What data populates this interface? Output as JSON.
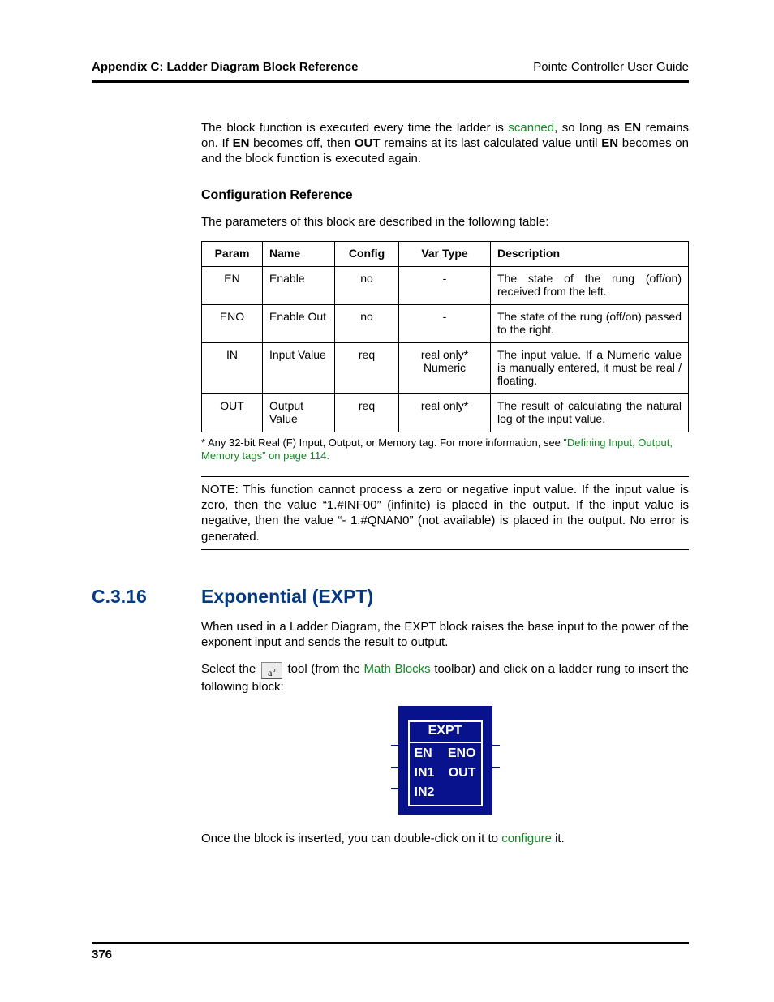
{
  "header": {
    "left": "Appendix C: Ladder Diagram Block Reference",
    "right": "Pointe Controller User Guide"
  },
  "intro": {
    "p1_a": "The block function is executed every time the ladder is ",
    "scanned": "scanned",
    "p1_b": ", so long as ",
    "en1": "EN",
    "p1_c": " remains on. If ",
    "en2": "EN",
    "p1_d": " becomes off, then ",
    "out": "OUT",
    "p1_e": " remains at its last calculated value until ",
    "en3": "EN",
    "p1_f": " becomes on and the block function is executed again."
  },
  "config_ref": {
    "heading": "Configuration Reference",
    "lead": "The parameters of this block are described in the following table:",
    "cols": [
      "Param",
      "Name",
      "Config",
      "Var Type",
      "Description"
    ],
    "rows": [
      {
        "param": "EN",
        "name": "Enable",
        "config": "no",
        "vartype": "-",
        "desc": "The state of the rung (off/on) received from the left."
      },
      {
        "param": "ENO",
        "name": "Enable Out",
        "config": "no",
        "vartype": "-",
        "desc": "The state of the rung (off/on) passed to the right."
      },
      {
        "param": "IN",
        "name": "Input Value",
        "config": "req",
        "vartype": "real only* Numeric",
        "desc": "The input value. If a Numeric value is manually entered, it must be real / floating."
      },
      {
        "param": "OUT",
        "name": "Output Value",
        "config": "req",
        "vartype": "real only*",
        "desc": "The result of calculating the natural log of the input value."
      }
    ],
    "footnote_a": "* Any 32-bit Real (F) Input, Output, or Memory tag. For more information, see “",
    "footnote_link": "Defining Input, Output, Memory tags",
    "footnote_b": "” on page 114.",
    "note": "NOTE: This function cannot process a zero or negative input value. If the input value is zero, then the value “1.#INF00” (infinite) is placed in the output. If the input value is negative, then the value “- 1.#QNAN0” (not available) is placed in the output. No error is generated."
  },
  "section": {
    "number": "C.3.16",
    "title": "Exponential (EXPT)",
    "p1": "When used in a Ladder Diagram, the EXPT block raises the base input to the power of the exponent input and sends the result to output.",
    "p2_a": "Select the ",
    "p2_b": " tool (from the ",
    "math_blocks": "Math Blocks",
    "p2_c": " toolbar) and click on a ladder rung to insert the following block:",
    "tool_icon_label": "a",
    "tool_icon_sup": "b",
    "block": {
      "title": "EXPT",
      "en": "EN",
      "eno": "ENO",
      "in1": "IN1",
      "out": "OUT",
      "in2": "IN2"
    },
    "p3_a": "Once the block is inserted, you can double-click on it to ",
    "configure": "configure",
    "p3_b": " it."
  },
  "footer": {
    "page": "376"
  }
}
